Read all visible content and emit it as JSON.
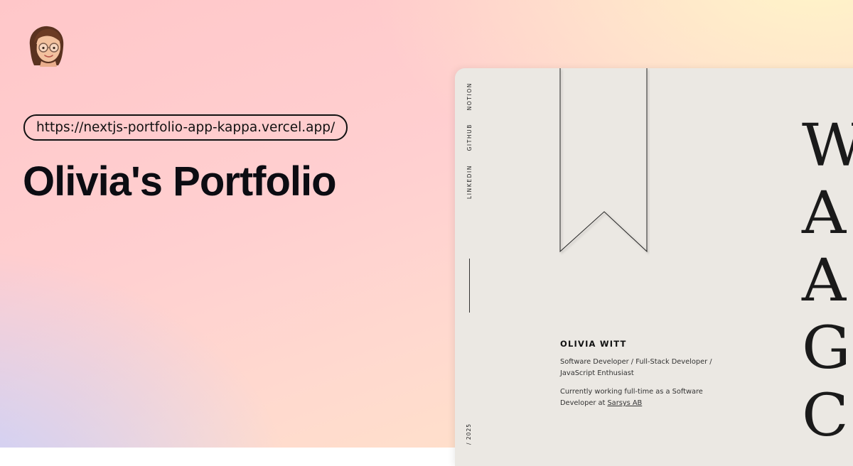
{
  "url": "https://nextjs-portfolio-app-kappa.vercel.app/",
  "title": "Olivia's Portfolio",
  "preview": {
    "nav": [
      {
        "label": "NOTION"
      },
      {
        "label": "GITHUB"
      },
      {
        "label": "LINKEDIN"
      }
    ],
    "year": "/ 2025",
    "name": "OLIVIA WITT",
    "roles": "Software Developer / Full-Stack Developer / JavaScript Enthusiast",
    "working_prefix": "Currently working full-time as a Software Developer at ",
    "company_link": "Sarsys AB",
    "big_letters": [
      "W",
      "A",
      "A",
      "G",
      "C"
    ]
  },
  "colors": {
    "card_bg": "#ebe8e3",
    "text_dark": "#0c0c12"
  },
  "icons": {
    "avatar": "memoji-avatar-with-glasses"
  }
}
